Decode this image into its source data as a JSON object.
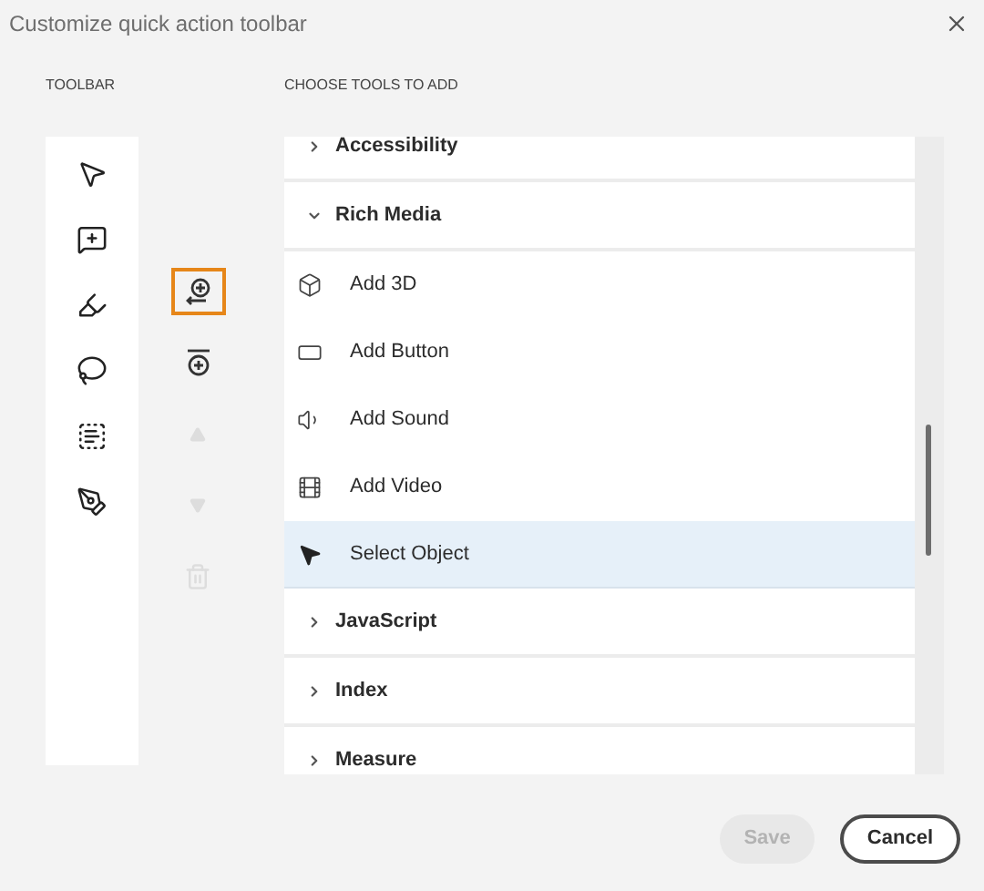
{
  "window": {
    "title": "Customize quick action toolbar"
  },
  "toolbar": {
    "heading": "TOOLBAR"
  },
  "actions": [
    {
      "kind": "add",
      "selected": true,
      "disabled": false
    },
    {
      "kind": "divider",
      "selected": false,
      "disabled": false
    },
    {
      "kind": "up",
      "selected": false,
      "disabled": true
    },
    {
      "kind": "down",
      "selected": false,
      "disabled": true
    },
    {
      "kind": "delete",
      "selected": false,
      "disabled": true
    }
  ],
  "tools_list": {
    "heading": "CHOOSE TOOLS TO ADD",
    "items": [
      {
        "kind": "category",
        "label": "Accessibility",
        "expanded": false
      },
      {
        "kind": "category",
        "label": "Rich Media",
        "expanded": true
      },
      {
        "kind": "tool",
        "label": "Add 3D",
        "selected": false
      },
      {
        "kind": "tool",
        "label": "Add Button",
        "selected": false
      },
      {
        "kind": "tool",
        "label": "Add Sound",
        "selected": false
      },
      {
        "kind": "tool",
        "label": "Add Video",
        "selected": false
      },
      {
        "kind": "tool",
        "label": "Select Object",
        "selected": true
      },
      {
        "kind": "category",
        "label": "JavaScript",
        "expanded": false
      },
      {
        "kind": "category",
        "label": "Index",
        "expanded": false
      },
      {
        "kind": "category",
        "label": "Measure",
        "expanded": false
      }
    ]
  },
  "buttons": [
    {
      "kind": "save",
      "label": "Save",
      "disabled": true
    },
    {
      "kind": "cancel",
      "label": "Cancel",
      "disabled": false
    }
  ]
}
